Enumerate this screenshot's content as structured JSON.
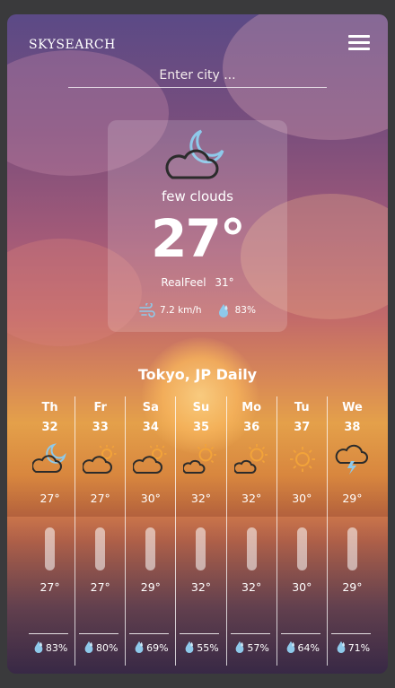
{
  "app": {
    "brand": "SKYSEARCH"
  },
  "search": {
    "placeholder": "Enter city ..."
  },
  "current": {
    "icon": "night-cloud-moon-icon",
    "description": "few clouds",
    "temperature": "27°",
    "realfeel_label": "RealFeel",
    "realfeel_value": "31°",
    "wind": "7.2 km/h",
    "humidity": "83%"
  },
  "daily": {
    "title": "Tokyo, JP Daily",
    "days": [
      {
        "name": "Th",
        "date": "32",
        "icon": "cloud-moon-icon",
        "max": "27°",
        "min": "27°",
        "humidity": "83%"
      },
      {
        "name": "Fr",
        "date": "33",
        "icon": "cloud-sun-icon",
        "max": "27°",
        "min": "27°",
        "humidity": "80%"
      },
      {
        "name": "Sa",
        "date": "34",
        "icon": "cloud-sun-icon",
        "max": "30°",
        "min": "29°",
        "humidity": "69%"
      },
      {
        "name": "Su",
        "date": "35",
        "icon": "sun-small-cloud-icon",
        "max": "32°",
        "min": "32°",
        "humidity": "55%"
      },
      {
        "name": "Mo",
        "date": "36",
        "icon": "sun-small-cloud-icon",
        "max": "32°",
        "min": "32°",
        "humidity": "57%"
      },
      {
        "name": "Tu",
        "date": "37",
        "icon": "sun-icon",
        "max": "30°",
        "min": "30°",
        "humidity": "64%"
      },
      {
        "name": "We",
        "date": "38",
        "icon": "storm-cloud-icon",
        "max": "29°",
        "min": "29°",
        "humidity": "71%"
      }
    ]
  },
  "colors": {
    "icon_orange": "#f2a33a",
    "icon_blue": "#8ec9ea",
    "icon_dark": "#2b2b2b"
  }
}
